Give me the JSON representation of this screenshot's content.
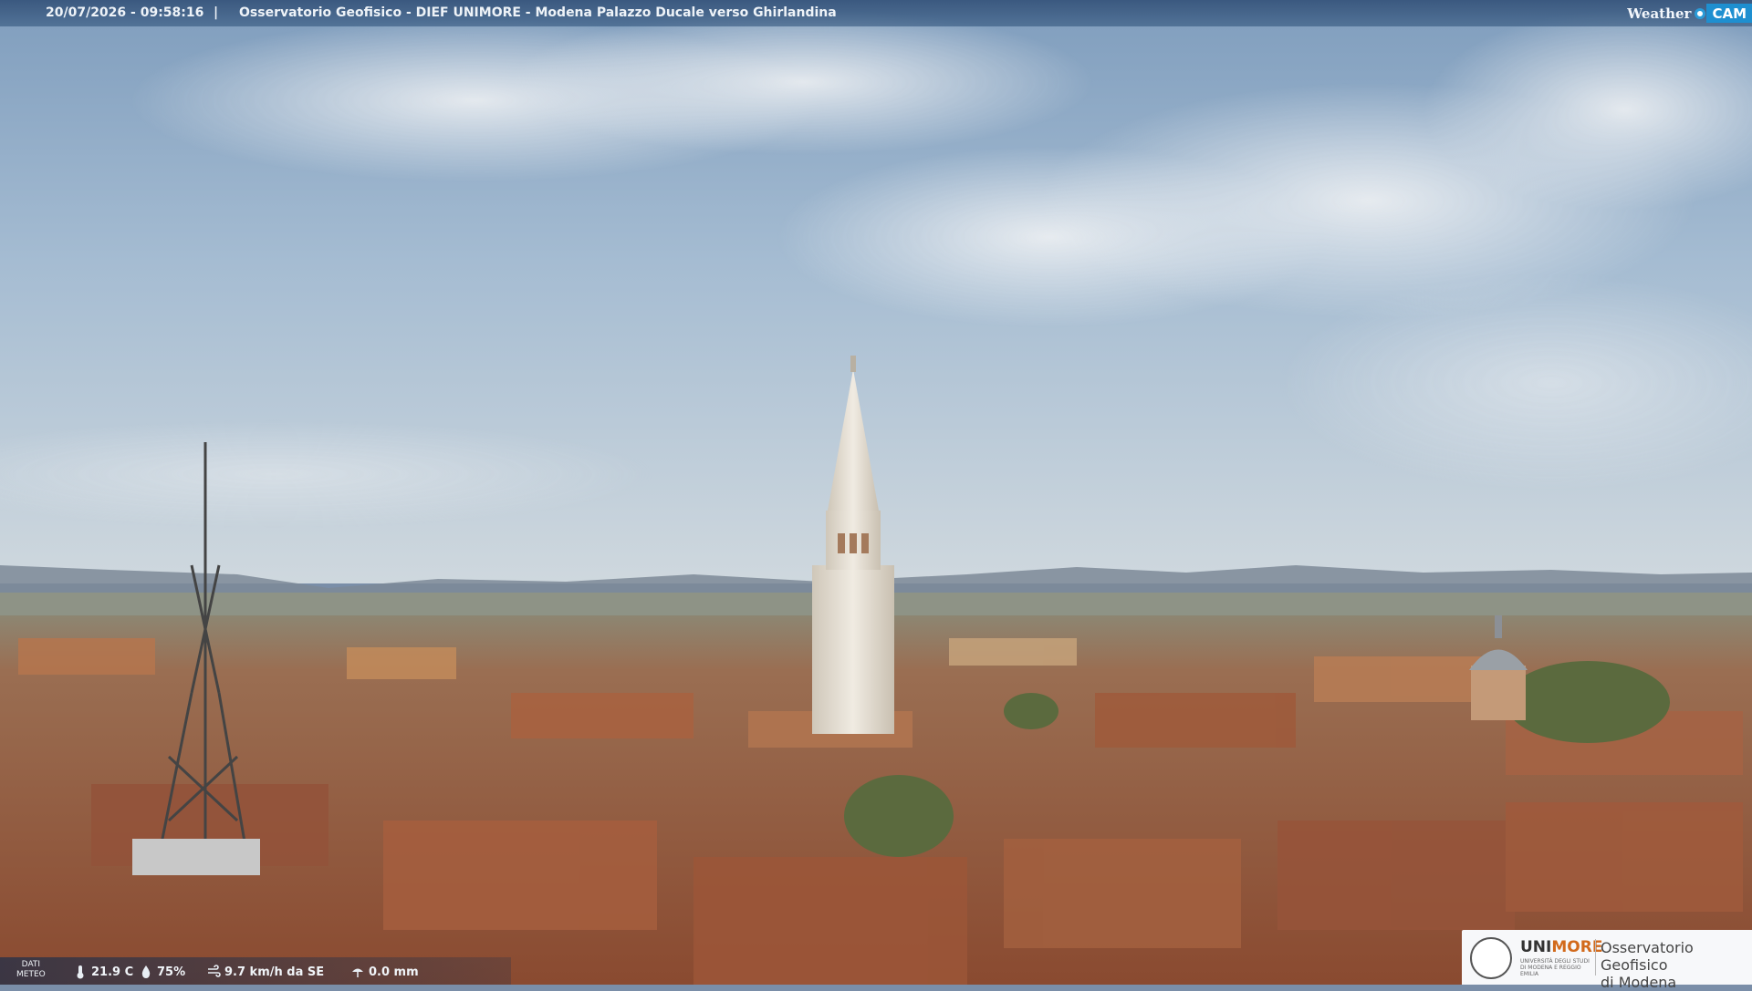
{
  "overlay_top": {
    "timestamp": "20/07/2026 - 09:58:16",
    "separator": "|",
    "title": "Osservatorio Geofisico - DIEF UNIMORE - Modena Palazzo Ducale verso Ghirlandina",
    "brand_word": "Weather",
    "brand_cam": "CAM"
  },
  "overlay_bottom": {
    "dati_label_line1": "DATI",
    "dati_label_line2": "METEO",
    "temperature": "21.9 C",
    "humidity": "75%",
    "wind": "9.7 km/h da SE",
    "rain": "0.0 mm"
  },
  "logo": {
    "uni_part1": "UNI",
    "uni_part2": "MORE",
    "uni_subtitle": "UNIVERSITÀ DEGLI STUDI DI MODENA E REGGIO EMILIA",
    "observatory_line1": "Osservatorio Geofisico",
    "observatory_line2": "di Modena"
  },
  "colors": {
    "sky_top": "#8aa6c4",
    "sky_horizon": "#c9d4dc",
    "roof": "#a0583a",
    "tower": "#e6e0d6",
    "accent_blue": "#1e8fd0",
    "unimore_orange": "#d26a1c"
  },
  "icons": [
    "thermometer-icon",
    "humidity-drop-icon",
    "wind-icon",
    "rain-icon",
    "weathercam-dot-icon",
    "unimore-seal-icon"
  ]
}
